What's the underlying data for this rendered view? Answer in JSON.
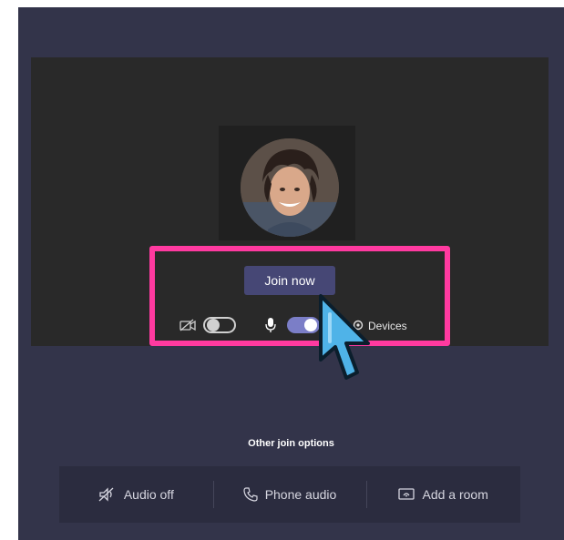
{
  "prejoin": {
    "join_label": "Join now",
    "camera": {
      "icon": "camera-off-icon",
      "state": "off"
    },
    "mic": {
      "icon": "microphone-icon",
      "state": "on"
    },
    "devices_label": "Devices",
    "devices_icon": "gear-icon"
  },
  "other_options": {
    "title": "Other join options",
    "items": [
      {
        "label": "Audio off",
        "icon": "speaker-off-icon"
      },
      {
        "label": "Phone audio",
        "icon": "phone-icon"
      },
      {
        "label": "Add a room",
        "icon": "cast-icon"
      }
    ]
  },
  "colors": {
    "background": "#33344a",
    "preview": "#292929",
    "join_button": "#464775",
    "toggle_on": "#7b7ec7",
    "highlight": "#ff3aa0",
    "cursor": "#4fb3e8"
  }
}
